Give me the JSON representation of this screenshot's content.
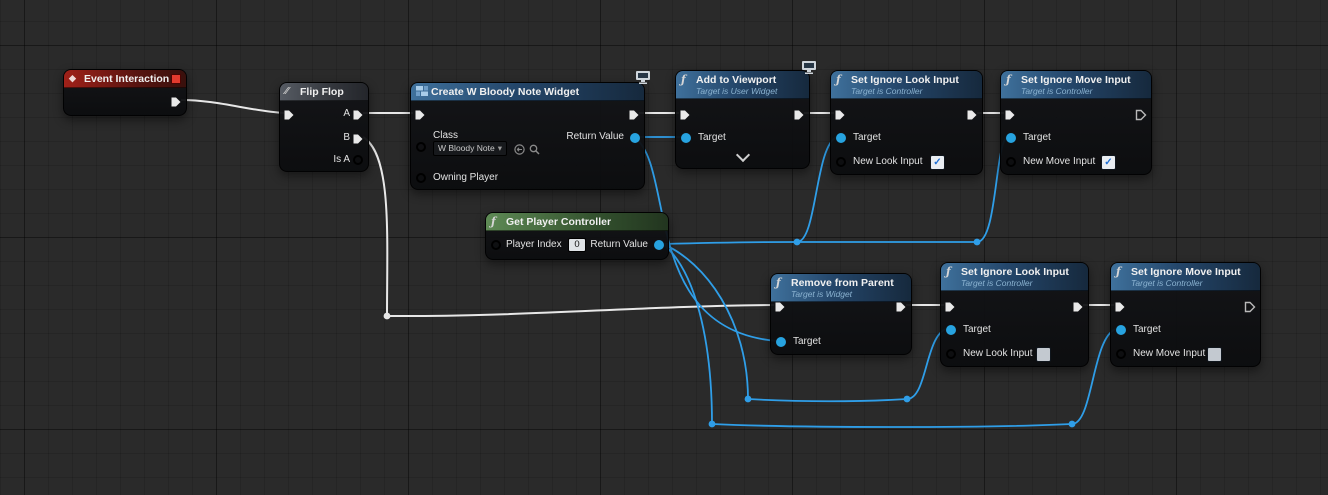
{
  "icons": {
    "function_glyph": "ƒ",
    "event_diamond_glyph": "◆",
    "macro_glyph": "⁄⁄",
    "caret_down": "▾"
  },
  "palette": {
    "exec_wire": "#e8e8e8",
    "data_wire": "#2f9ee8",
    "object_pin": "#27a3e0",
    "class_pin": "#b15fe2",
    "bool_pin": "#c00a0a",
    "int_pin": "#44d465",
    "header_function": "#3f719c",
    "header_event": "#a02119",
    "header_pure": "#5e8a55",
    "header_macro": "#565b63"
  },
  "nodes": {
    "event_interaction": {
      "title": "Event Interaction"
    },
    "flip_flop": {
      "title": "Flip Flop",
      "pin_a": "A",
      "pin_b": "B",
      "pin_is_a": "Is A"
    },
    "create_widget": {
      "title": "Create W Bloody Note Widget",
      "class_label": "Class",
      "class_value": "W Bloody Note",
      "owning_player_label": "Owning Player",
      "return_value_label": "Return Value"
    },
    "add_to_viewport": {
      "title": "Add to Viewport",
      "subtitle": "Target is User Widget",
      "target_label": "Target"
    },
    "set_ignore_look_top": {
      "title": "Set Ignore Look Input",
      "subtitle": "Target is Controller",
      "target_label": "Target",
      "param_label": "New Look Input",
      "checkbox_state": "checked",
      "check_glyph": "✓"
    },
    "set_ignore_move_top": {
      "title": "Set Ignore Move Input",
      "subtitle": "Target is Controller",
      "target_label": "Target",
      "param_label": "New Move Input",
      "checkbox_state": "checked",
      "check_glyph": "✓"
    },
    "get_player_controller": {
      "title": "Get Player Controller",
      "player_index_label": "Player Index",
      "player_index_value": "0",
      "return_value_label": "Return Value"
    },
    "remove_from_parent": {
      "title": "Remove from Parent",
      "subtitle": "Target is Widget",
      "target_label": "Target"
    },
    "set_ignore_look_bottom": {
      "title": "Set Ignore Look Input",
      "subtitle": "Target is Controller",
      "target_label": "Target",
      "param_label": "New Look Input",
      "checkbox_state": "unchecked",
      "check_glyph": ""
    },
    "set_ignore_move_bottom": {
      "title": "Set Ignore Move Input",
      "subtitle": "Target is Controller",
      "target_label": "Target",
      "param_label": "New Move Input",
      "checkbox_state": "unchecked",
      "check_glyph": ""
    }
  }
}
